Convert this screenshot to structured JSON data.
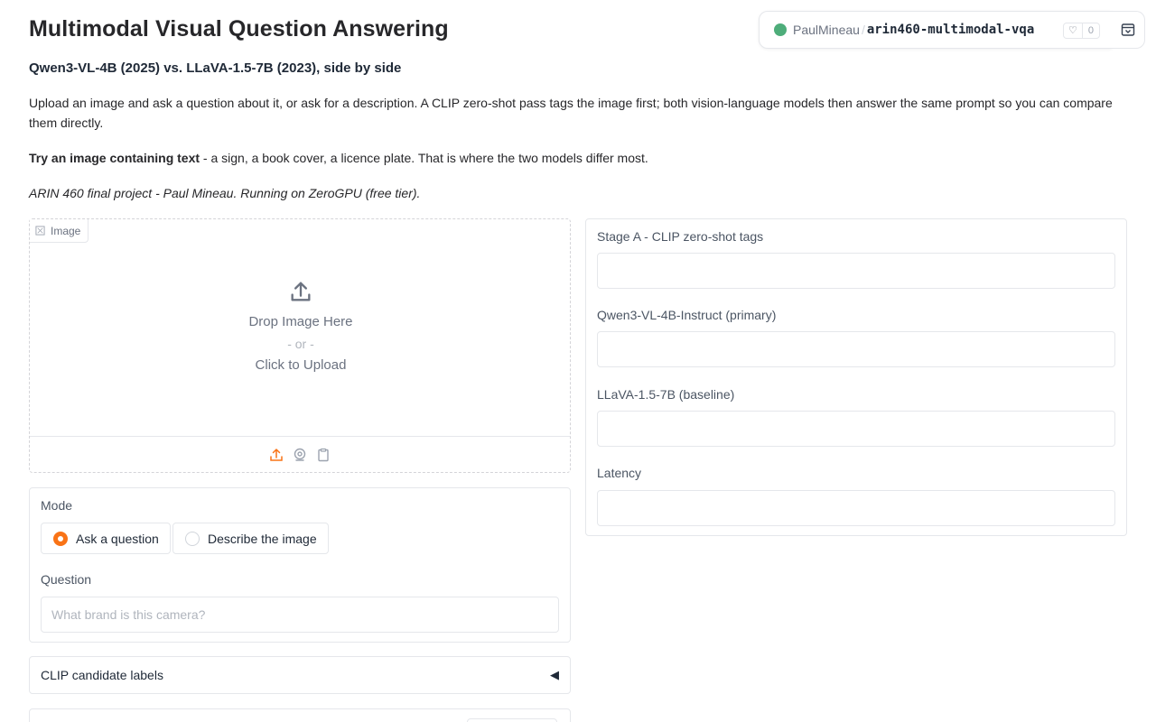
{
  "header": {
    "title": "Multimodal Visual Question Answering",
    "subtitle": "Qwen3-VL-4B (2025) vs. LLaVA-1.5-7B (2023), side by side",
    "description": "Upload an image and ask a question about it, or ask for a description. A CLIP zero-shot pass tags the image first; both vision-language models then answer the same prompt so you can compare them directly.",
    "tip_bold": "Try an image containing text",
    "tip_rest": " - a sign, a book cover, a licence plate. That is where the two models differ most.",
    "credit": "ARIN 460 final project - Paul Mineau. Running on ZeroGPU (free tier)."
  },
  "hf_badge": {
    "user": "PaulMineau",
    "slash": "/",
    "repo": "arin460-multimodal-vqa",
    "likes": "0",
    "status_color": "#4ead7a"
  },
  "image_input": {
    "label": "Image",
    "drop_text": "Drop Image Here",
    "or_text": "- or -",
    "click_text": "Click to Upload",
    "accent_color": "#f97316"
  },
  "controls": {
    "mode_label": "Mode",
    "mode_options": [
      "Ask a question",
      "Describe the image"
    ],
    "selected_mode": "Ask a question",
    "question_label": "Question",
    "question_placeholder": "What brand is this camera?",
    "question_value": ""
  },
  "accordion": {
    "label": "CLIP candidate labels",
    "arrow": "◀"
  },
  "outputs": {
    "clip_label": "Stage A - CLIP zero-shot tags",
    "clip_value": "",
    "qwen_label": "Qwen3-VL-4B-Instruct (primary)",
    "qwen_value": "",
    "llava_label": "LLaVA-1.5-7B (baseline)",
    "llava_value": "",
    "latency_label": "Latency",
    "latency_value": ""
  }
}
